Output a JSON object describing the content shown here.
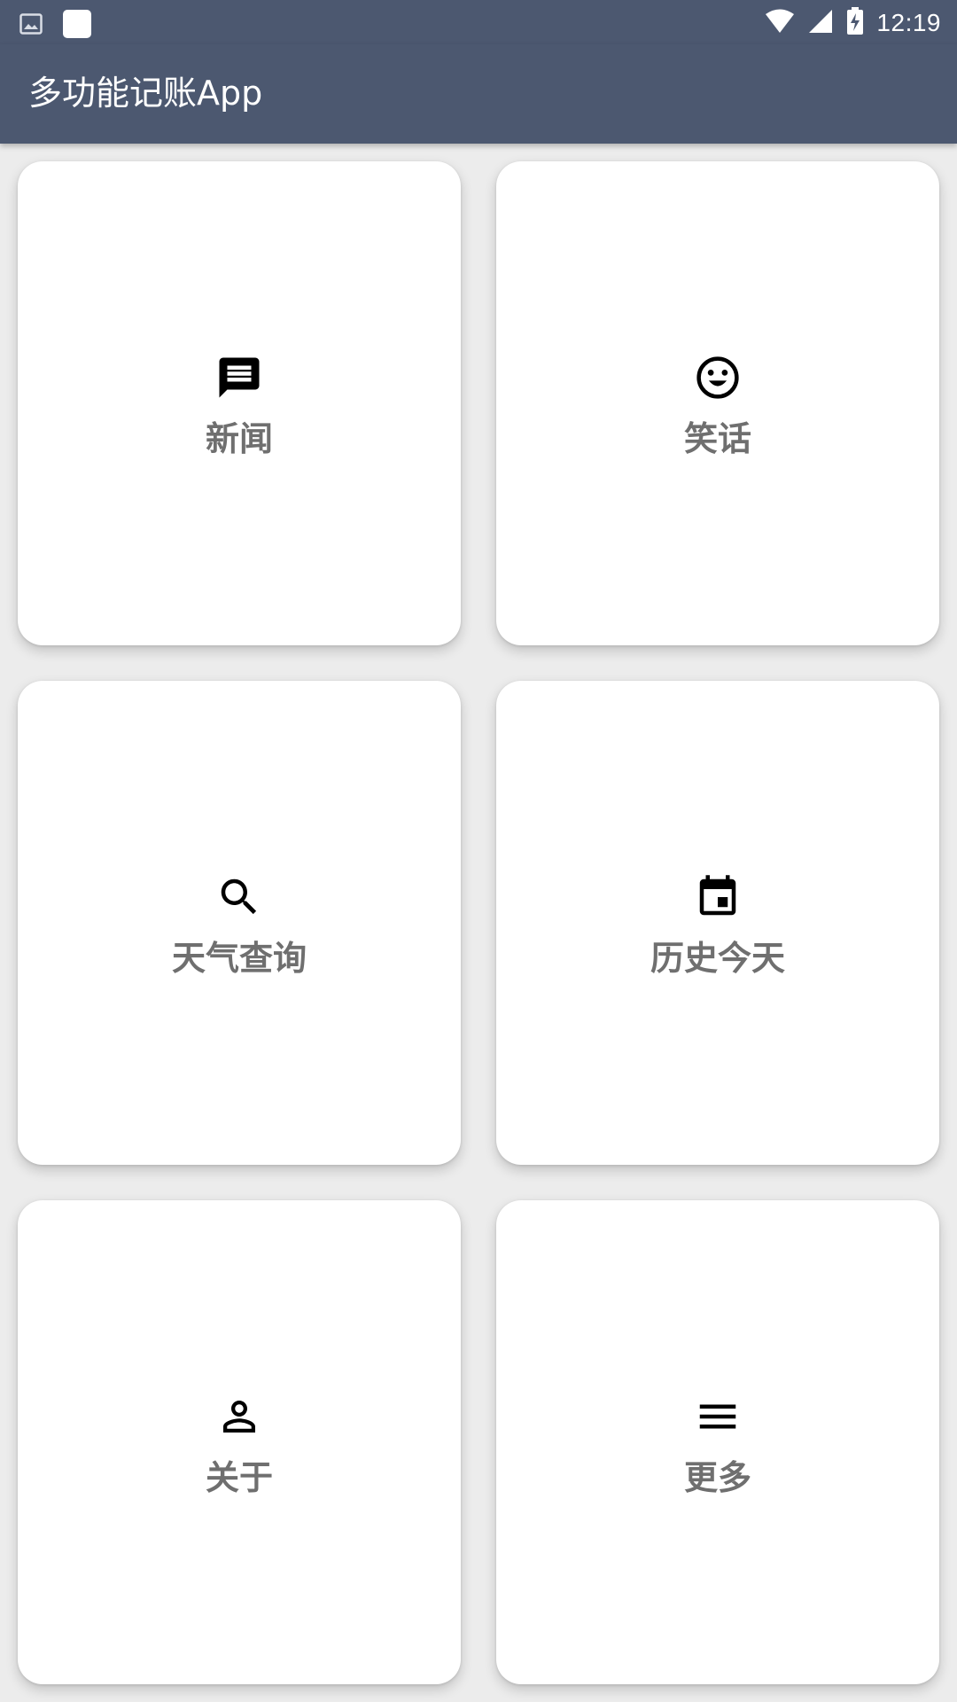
{
  "status_bar": {
    "time": "12:19",
    "left_icons": [
      "image-icon",
      "square-icon"
    ],
    "right_icons": [
      "wifi-icon",
      "signal-icon",
      "battery-charging-icon"
    ]
  },
  "app_bar": {
    "title": "多功能记账App"
  },
  "colors": {
    "primary": "#4c5870",
    "background": "#ececec",
    "card": "#ffffff",
    "label": "#6f6f6f"
  },
  "menu": {
    "items": [
      {
        "label": "新闻",
        "icon": "message-icon"
      },
      {
        "label": "笑话",
        "icon": "smiley-icon"
      },
      {
        "label": "天气查询",
        "icon": "search-icon"
      },
      {
        "label": "历史今天",
        "icon": "calendar-icon"
      },
      {
        "label": "关于",
        "icon": "person-icon"
      },
      {
        "label": "更多",
        "icon": "menu-icon"
      }
    ]
  }
}
